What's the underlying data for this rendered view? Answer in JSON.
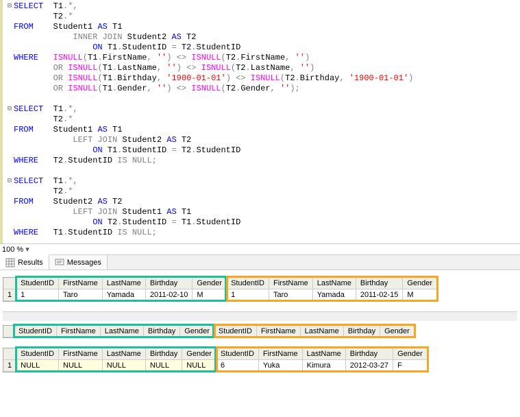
{
  "editor": {
    "zoom": "100 %",
    "lines": [
      {
        "fold": "⊟",
        "tokens": [
          {
            "c": "kw",
            "t": "SELECT"
          },
          {
            "c": "txt",
            "t": "  T1"
          },
          {
            "c": "op",
            "t": ".*,"
          }
        ]
      },
      {
        "tokens": [
          {
            "c": "txt",
            "t": "        T2"
          },
          {
            "c": "op",
            "t": ".*"
          }
        ]
      },
      {
        "tokens": [
          {
            "c": "kw",
            "t": "FROM"
          },
          {
            "c": "txt",
            "t": "    Student1 "
          },
          {
            "c": "kw",
            "t": "AS"
          },
          {
            "c": "txt",
            "t": " T1"
          }
        ]
      },
      {
        "tokens": [
          {
            "c": "txt",
            "t": "            "
          },
          {
            "c": "gy",
            "t": "INNER JOIN"
          },
          {
            "c": "txt",
            "t": " Student2 "
          },
          {
            "c": "kw",
            "t": "AS"
          },
          {
            "c": "txt",
            "t": " T2"
          }
        ]
      },
      {
        "tokens": [
          {
            "c": "txt",
            "t": "                "
          },
          {
            "c": "kw",
            "t": "ON"
          },
          {
            "c": "txt",
            "t": " T1"
          },
          {
            "c": "op",
            "t": "."
          },
          {
            "c": "txt",
            "t": "StudentID "
          },
          {
            "c": "op",
            "t": "="
          },
          {
            "c": "txt",
            "t": " T2"
          },
          {
            "c": "op",
            "t": "."
          },
          {
            "c": "txt",
            "t": "StudentID"
          }
        ]
      },
      {
        "tokens": [
          {
            "c": "kw",
            "t": "WHERE"
          },
          {
            "c": "txt",
            "t": "   "
          },
          {
            "c": "fn",
            "t": "ISNULL"
          },
          {
            "c": "op",
            "t": "("
          },
          {
            "c": "txt",
            "t": "T1"
          },
          {
            "c": "op",
            "t": "."
          },
          {
            "c": "txt",
            "t": "FirstName"
          },
          {
            "c": "op",
            "t": ", "
          },
          {
            "c": "str",
            "t": "''"
          },
          {
            "c": "op",
            "t": ") <> "
          },
          {
            "c": "fn",
            "t": "ISNULL"
          },
          {
            "c": "op",
            "t": "("
          },
          {
            "c": "txt",
            "t": "T2"
          },
          {
            "c": "op",
            "t": "."
          },
          {
            "c": "txt",
            "t": "FirstName"
          },
          {
            "c": "op",
            "t": ", "
          },
          {
            "c": "str",
            "t": "''"
          },
          {
            "c": "op",
            "t": ")"
          }
        ]
      },
      {
        "tokens": [
          {
            "c": "txt",
            "t": "        "
          },
          {
            "c": "gy",
            "t": "OR"
          },
          {
            "c": "txt",
            "t": " "
          },
          {
            "c": "fn",
            "t": "ISNULL"
          },
          {
            "c": "op",
            "t": "("
          },
          {
            "c": "txt",
            "t": "T1"
          },
          {
            "c": "op",
            "t": "."
          },
          {
            "c": "txt",
            "t": "LastName"
          },
          {
            "c": "op",
            "t": ", "
          },
          {
            "c": "str",
            "t": "''"
          },
          {
            "c": "op",
            "t": ") <> "
          },
          {
            "c": "fn",
            "t": "ISNULL"
          },
          {
            "c": "op",
            "t": "("
          },
          {
            "c": "txt",
            "t": "T2"
          },
          {
            "c": "op",
            "t": "."
          },
          {
            "c": "txt",
            "t": "LastName"
          },
          {
            "c": "op",
            "t": ", "
          },
          {
            "c": "str",
            "t": "''"
          },
          {
            "c": "op",
            "t": ")"
          }
        ]
      },
      {
        "tokens": [
          {
            "c": "txt",
            "t": "        "
          },
          {
            "c": "gy",
            "t": "OR"
          },
          {
            "c": "txt",
            "t": " "
          },
          {
            "c": "fn",
            "t": "ISNULL"
          },
          {
            "c": "op",
            "t": "("
          },
          {
            "c": "txt",
            "t": "T1"
          },
          {
            "c": "op",
            "t": "."
          },
          {
            "c": "txt",
            "t": "Birthday"
          },
          {
            "c": "op",
            "t": ", "
          },
          {
            "c": "str",
            "t": "'1900-01-01'"
          },
          {
            "c": "op",
            "t": ") <> "
          },
          {
            "c": "fn",
            "t": "ISNULL"
          },
          {
            "c": "op",
            "t": "("
          },
          {
            "c": "txt",
            "t": "T2"
          },
          {
            "c": "op",
            "t": "."
          },
          {
            "c": "txt",
            "t": "Birthday"
          },
          {
            "c": "op",
            "t": ", "
          },
          {
            "c": "str",
            "t": "'1900-01-01'"
          },
          {
            "c": "op",
            "t": ")"
          }
        ]
      },
      {
        "tokens": [
          {
            "c": "txt",
            "t": "        "
          },
          {
            "c": "gy",
            "t": "OR"
          },
          {
            "c": "txt",
            "t": " "
          },
          {
            "c": "fn",
            "t": "ISNULL"
          },
          {
            "c": "op",
            "t": "("
          },
          {
            "c": "txt",
            "t": "T1"
          },
          {
            "c": "op",
            "t": "."
          },
          {
            "c": "txt",
            "t": "Gender"
          },
          {
            "c": "op",
            "t": ", "
          },
          {
            "c": "str",
            "t": "''"
          },
          {
            "c": "op",
            "t": ") <> "
          },
          {
            "c": "fn",
            "t": "ISNULL"
          },
          {
            "c": "op",
            "t": "("
          },
          {
            "c": "txt",
            "t": "T2"
          },
          {
            "c": "op",
            "t": "."
          },
          {
            "c": "txt",
            "t": "Gender"
          },
          {
            "c": "op",
            "t": ", "
          },
          {
            "c": "str",
            "t": "''"
          },
          {
            "c": "op",
            "t": ");"
          }
        ]
      },
      {
        "tokens": [
          {
            "c": "txt",
            "t": " "
          }
        ]
      },
      {
        "fold": "⊟",
        "tokens": [
          {
            "c": "kw",
            "t": "SELECT"
          },
          {
            "c": "txt",
            "t": "  T1"
          },
          {
            "c": "op",
            "t": ".*,"
          }
        ]
      },
      {
        "tokens": [
          {
            "c": "txt",
            "t": "        T2"
          },
          {
            "c": "op",
            "t": ".*"
          }
        ]
      },
      {
        "tokens": [
          {
            "c": "kw",
            "t": "FROM"
          },
          {
            "c": "txt",
            "t": "    Student1 "
          },
          {
            "c": "kw",
            "t": "AS"
          },
          {
            "c": "txt",
            "t": " T1"
          }
        ]
      },
      {
        "tokens": [
          {
            "c": "txt",
            "t": "            "
          },
          {
            "c": "gy",
            "t": "LEFT JOIN"
          },
          {
            "c": "txt",
            "t": " Student2 "
          },
          {
            "c": "kw",
            "t": "AS"
          },
          {
            "c": "txt",
            "t": " T2"
          }
        ]
      },
      {
        "tokens": [
          {
            "c": "txt",
            "t": "                "
          },
          {
            "c": "kw",
            "t": "ON"
          },
          {
            "c": "txt",
            "t": " T1"
          },
          {
            "c": "op",
            "t": "."
          },
          {
            "c": "txt",
            "t": "StudentID "
          },
          {
            "c": "op",
            "t": "="
          },
          {
            "c": "txt",
            "t": " T2"
          },
          {
            "c": "op",
            "t": "."
          },
          {
            "c": "txt",
            "t": "StudentID"
          }
        ]
      },
      {
        "tokens": [
          {
            "c": "kw",
            "t": "WHERE"
          },
          {
            "c": "txt",
            "t": "   T2"
          },
          {
            "c": "op",
            "t": "."
          },
          {
            "c": "txt",
            "t": "StudentID "
          },
          {
            "c": "gy",
            "t": "IS NULL"
          },
          {
            "c": "op",
            "t": ";"
          }
        ]
      },
      {
        "tokens": [
          {
            "c": "txt",
            "t": " "
          }
        ]
      },
      {
        "fold": "⊟",
        "tokens": [
          {
            "c": "kw",
            "t": "SELECT"
          },
          {
            "c": "txt",
            "t": "  T1"
          },
          {
            "c": "op",
            "t": ".*,"
          }
        ]
      },
      {
        "tokens": [
          {
            "c": "txt",
            "t": "        T2"
          },
          {
            "c": "op",
            "t": ".*"
          }
        ]
      },
      {
        "tokens": [
          {
            "c": "kw",
            "t": "FROM"
          },
          {
            "c": "txt",
            "t": "    Student2 "
          },
          {
            "c": "kw",
            "t": "AS"
          },
          {
            "c": "txt",
            "t": " T2"
          }
        ]
      },
      {
        "tokens": [
          {
            "c": "txt",
            "t": "            "
          },
          {
            "c": "gy",
            "t": "LEFT JOIN"
          },
          {
            "c": "txt",
            "t": " Student1 "
          },
          {
            "c": "kw",
            "t": "AS"
          },
          {
            "c": "txt",
            "t": " T1"
          }
        ]
      },
      {
        "tokens": [
          {
            "c": "txt",
            "t": "                "
          },
          {
            "c": "kw",
            "t": "ON"
          },
          {
            "c": "txt",
            "t": " T2"
          },
          {
            "c": "op",
            "t": "."
          },
          {
            "c": "txt",
            "t": "StudentID "
          },
          {
            "c": "op",
            "t": "="
          },
          {
            "c": "txt",
            "t": " T1"
          },
          {
            "c": "op",
            "t": "."
          },
          {
            "c": "txt",
            "t": "StudentID"
          }
        ]
      },
      {
        "tokens": [
          {
            "c": "kw",
            "t": "WHERE"
          },
          {
            "c": "txt",
            "t": "   T1"
          },
          {
            "c": "op",
            "t": "."
          },
          {
            "c": "txt",
            "t": "StudentID "
          },
          {
            "c": "gy",
            "t": "IS NULL"
          },
          {
            "c": "op",
            "t": ";"
          }
        ]
      }
    ]
  },
  "tabs": {
    "results": "Results",
    "messages": "Messages"
  },
  "headers": [
    "StudentID",
    "FirstName",
    "LastName",
    "Birthday",
    "Gender",
    "StudentID",
    "FirstName",
    "LastName",
    "Birthday",
    "Gender"
  ],
  "result1": {
    "rows": [
      [
        "1",
        "Taro",
        "Yamada",
        "2011-02-10",
        "M",
        "1",
        "Taro",
        "Yamada",
        "2011-02-15",
        "M"
      ]
    ]
  },
  "result2": {
    "rows": []
  },
  "result3": {
    "rows": [
      [
        "NULL",
        "NULL",
        "NULL",
        "NULL",
        "NULL",
        "6",
        "Yuka",
        "Kimura",
        "2012-03-27",
        "F"
      ]
    ],
    "nullCols": [
      0,
      1,
      2,
      3,
      4
    ]
  }
}
